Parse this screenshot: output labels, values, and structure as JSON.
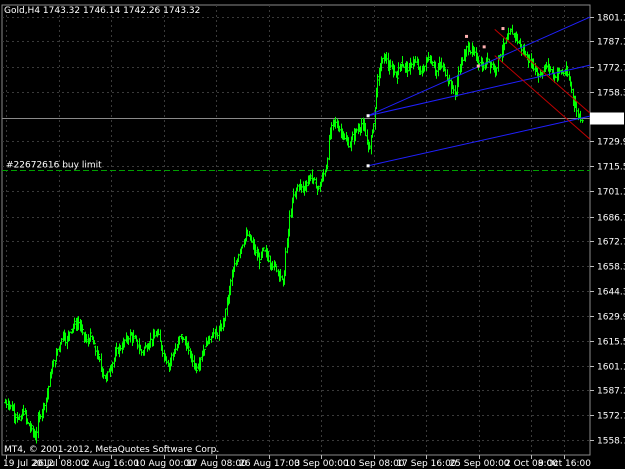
{
  "header": {
    "text": "Gold,H4  1743.32 1746.14 1742.26 1743.32"
  },
  "order_label": "#22672616 buy limit",
  "copyright": "MT4, © 2001-2012, MetaQuotes Software Corp.",
  "current_price_label": "1743.32",
  "colors": {
    "background": "#000000",
    "candles": "#00ff00",
    "grid": "#3a3a3a",
    "axis_text": "#ffffff",
    "channel_blue": "#2020ff",
    "channel_red": "#c00000",
    "order_line": "#00a000"
  },
  "chart_data": {
    "type": "candlestick",
    "symbol": "Gold",
    "timeframe": "H4",
    "ohlc_current": {
      "open": 1743.32,
      "high": 1746.14,
      "low": 1742.26,
      "close": 1743.32
    },
    "ylim": [
      1550.0,
      1808.0
    ],
    "y_ticks": [
      "1801.10",
      "1787.10",
      "1772.70",
      "1758.30",
      "1743.32",
      "1729.90",
      "1715.50",
      "1701.10",
      "1686.70",
      "1672.70",
      "1658.30",
      "1644.30",
      "1629.90",
      "1615.50",
      "1601.10",
      "1587.10",
      "1572.70",
      "1558.70"
    ],
    "y_tick_values": [
      1801.1,
      1787.1,
      1772.7,
      1758.3,
      1743.32,
      1729.9,
      1715.5,
      1701.1,
      1686.7,
      1672.7,
      1658.3,
      1644.3,
      1629.9,
      1615.5,
      1601.1,
      1587.1,
      1572.7,
      1558.7
    ],
    "x_ticks": [
      "19 Jul 2012",
      "26 Jul 08:00",
      "2 Aug 16:00",
      "10 Aug 00:00",
      "17 Aug 08:00",
      "26 Aug 17:00",
      "3 Sep 00:00",
      "10 Sep 08:00",
      "17 Sep 16:00",
      "25 Sep 00:00",
      "2 Oct 08:00",
      "9 Oct 16:00"
    ],
    "close_path": [
      1580,
      1577,
      1573,
      1570,
      1575,
      1568,
      1565,
      1560,
      1572,
      1578,
      1585,
      1598,
      1604,
      1612,
      1620,
      1616,
      1622,
      1625,
      1626,
      1620,
      1615,
      1618,
      1612,
      1606,
      1598,
      1594,
      1600,
      1605,
      1610,
      1612,
      1616,
      1619,
      1617,
      1613,
      1609,
      1612,
      1615,
      1617,
      1620,
      1612,
      1606,
      1602,
      1608,
      1612,
      1618,
      1615,
      1610,
      1604,
      1600,
      1606,
      1612,
      1616,
      1620,
      1619,
      1622,
      1628,
      1640,
      1652,
      1660,
      1668,
      1673,
      1676,
      1672,
      1666,
      1662,
      1667,
      1664,
      1660,
      1658,
      1655,
      1648,
      1672,
      1690,
      1700,
      1705,
      1702,
      1706,
      1710,
      1706,
      1703,
      1709,
      1715,
      1735,
      1741,
      1738,
      1735,
      1730,
      1728,
      1733,
      1737,
      1740,
      1733,
      1726,
      1740,
      1765,
      1775,
      1778,
      1772,
      1770,
      1768,
      1775,
      1773,
      1771,
      1776,
      1774,
      1769,
      1773,
      1778,
      1775,
      1770,
      1774,
      1771,
      1766,
      1760,
      1758,
      1773,
      1778,
      1784,
      1782,
      1778,
      1775,
      1772,
      1777,
      1774,
      1771,
      1779,
      1784,
      1788,
      1793,
      1791,
      1786,
      1782,
      1778,
      1775,
      1772,
      1768,
      1770,
      1773,
      1771,
      1767,
      1770,
      1769,
      1770,
      1763,
      1752,
      1745,
      1743
    ],
    "blue_channel": {
      "upper_line": [
        [
          0.6226,
          1744.5
        ],
        [
          1.0,
          1801.1
        ]
      ],
      "middle_line": [
        [
          0.6226,
          1744.5
        ],
        [
          1.0,
          1773.5
        ]
      ],
      "lower_line": [
        [
          0.6226,
          1715.8
        ],
        [
          1.0,
          1744.3
        ]
      ],
      "anchors": [
        [
          0.6226,
          1744.5
        ],
        [
          0.6226,
          1715.8
        ]
      ]
    },
    "red_channel": {
      "upper_line": [
        [
          0.838,
          1794.0
        ],
        [
          1.0,
          1746.0
        ]
      ],
      "lower_line": [
        [
          0.838,
          1779.0
        ],
        [
          1.0,
          1731.0
        ]
      ],
      "anchors": [
        [
          0.79,
          1790.0
        ],
        [
          0.82,
          1784.0
        ],
        [
          0.81,
          1773.0
        ],
        [
          0.852,
          1794.5
        ]
      ]
    },
    "order_line_price": 1713.4,
    "grid": true
  }
}
